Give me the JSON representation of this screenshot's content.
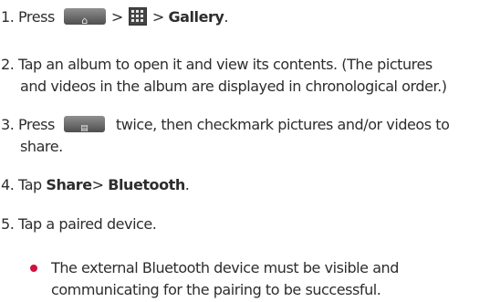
{
  "steps": [
    {
      "number": "1.",
      "lines": [
        {
          "press": "Press",
          "sep1": ">",
          "sep2": ">",
          "gallery": "Gallery",
          "period": "."
        }
      ]
    },
    {
      "number": "2.",
      "lines": [
        "Tap an album to open it and view its contents. (The pictures",
        "and videos in the album are displayed in chronological order.)"
      ]
    },
    {
      "number": "3.",
      "lines": [
        {
          "press": "Press",
          "rest": "twice, then checkmark pictures and/or videos to"
        },
        "share."
      ]
    },
    {
      "number": "4.",
      "lines": [
        {
          "tap": "Tap",
          "share": "Share",
          "sep": ">",
          "bluetooth": "Bluetooth",
          "period": "."
        }
      ]
    },
    {
      "number": "5.",
      "lines": [
        "Tap a paired device."
      ]
    }
  ],
  "note": {
    "lines": [
      "The external Bluetooth device must be visible and",
      "communicating for the pairing to be successful."
    ]
  },
  "icons": {
    "home_key": "home-key-icon",
    "apps_key": "apps-grid-icon",
    "menu_key": "menu-key-icon",
    "bullet": "bullet-dot"
  },
  "colors": {
    "text": "#2d2d2d",
    "bullet": "#d1123c",
    "key_button": "#6b6b6b"
  }
}
